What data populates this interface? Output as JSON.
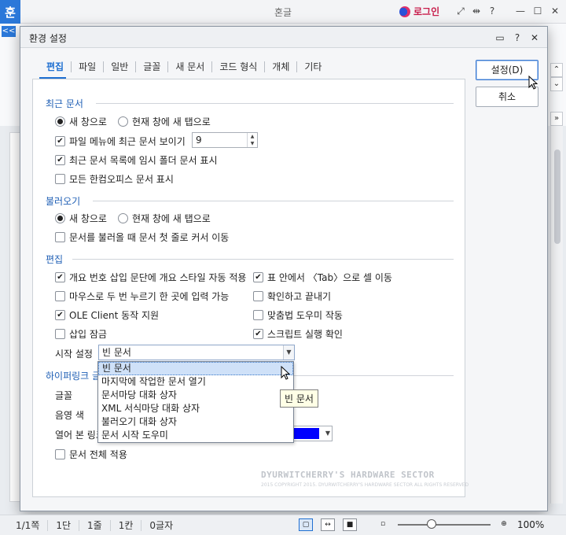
{
  "app": {
    "logo": "훈",
    "title": "혼글",
    "login": "로그인",
    "ribbon_toggle": "<<"
  },
  "dialog": {
    "title": "환경 설정",
    "tabs": [
      "편집",
      "파일",
      "일반",
      "글꼴",
      "새 문서",
      "코드 형식",
      "개체",
      "기타"
    ],
    "active_tab": "편집",
    "buttons": {
      "ok": "설정(D)",
      "cancel": "취소"
    },
    "recent": {
      "title": "최근 문서",
      "radio_new_window": "새 창으로",
      "radio_new_tab": "현재 창에 새 탭으로",
      "show_recent_in_file_menu": "파일 메뉴에 최근 문서 보이기",
      "recent_count": "9",
      "show_temp_folder": "최근 문서 목록에 임시 폴더 문서 표시",
      "show_all_hancom": "모든 한컴오피스 문서 표시"
    },
    "open": {
      "title": "불러오기",
      "radio_new_window": "새 창으로",
      "radio_new_tab": "현재 창에 새 탭으로",
      "move_cursor_first_line": "문서를 불러올 때 문서 첫 줄로 커서 이동"
    },
    "edit": {
      "title": "편집",
      "auto_style": "개요 번호 삽입 문단에 개요 스타일 자동 적용",
      "tab_cell_move": "표 안에서 〈Tab〉으로 셀 이동",
      "double_click_input": "마우스로 두 번 누르기 한 곳에 입력 가능",
      "confirm_quit": "확인하고 끝내기",
      "ole_client": "OLE Client 동작 지원",
      "spell_helper": "맞춤법 도우미 작동",
      "insert_lock": "삽입 잠금",
      "script_confirm": "스크립트 실행 확인",
      "start_setting_label": "시작 설정",
      "start_setting_value": "빈 문서",
      "start_options": [
        "빈 문서",
        "마지막에 작업한 문서 열기",
        "문서마당 대화 상자",
        "XML 서식마당 대화 상자",
        "불러오기 대화 상자",
        "문서 시작 도우미"
      ]
    },
    "hyperlink": {
      "title_partial": "하이퍼링크 글",
      "font_label": "글꼴",
      "shadow_color_label": "음영 색",
      "visited_link_label": "열어 본 링크",
      "apply_whole_doc": "문서 전체 적용"
    },
    "tooltip": "빈 문서",
    "watermark": "DYURWITCHERRY'S HARDWARE SECTOR",
    "watermark_sub": "2015 COPYRIGHT 2015. DYURWITCHERRY'S HARDWARE SECTOR ALL RIGHTS RESERVED"
  },
  "status": {
    "page": "1/1쪽",
    "section": "1단",
    "line": "1줄",
    "column": "1칸",
    "chars": "0글자",
    "zoom": "100%"
  },
  "colors": {
    "accent": "#1f6fd1",
    "visited_link_color": "#0000ff",
    "logo_bg": "#2b78d9",
    "login_text": "#c81e4c"
  }
}
